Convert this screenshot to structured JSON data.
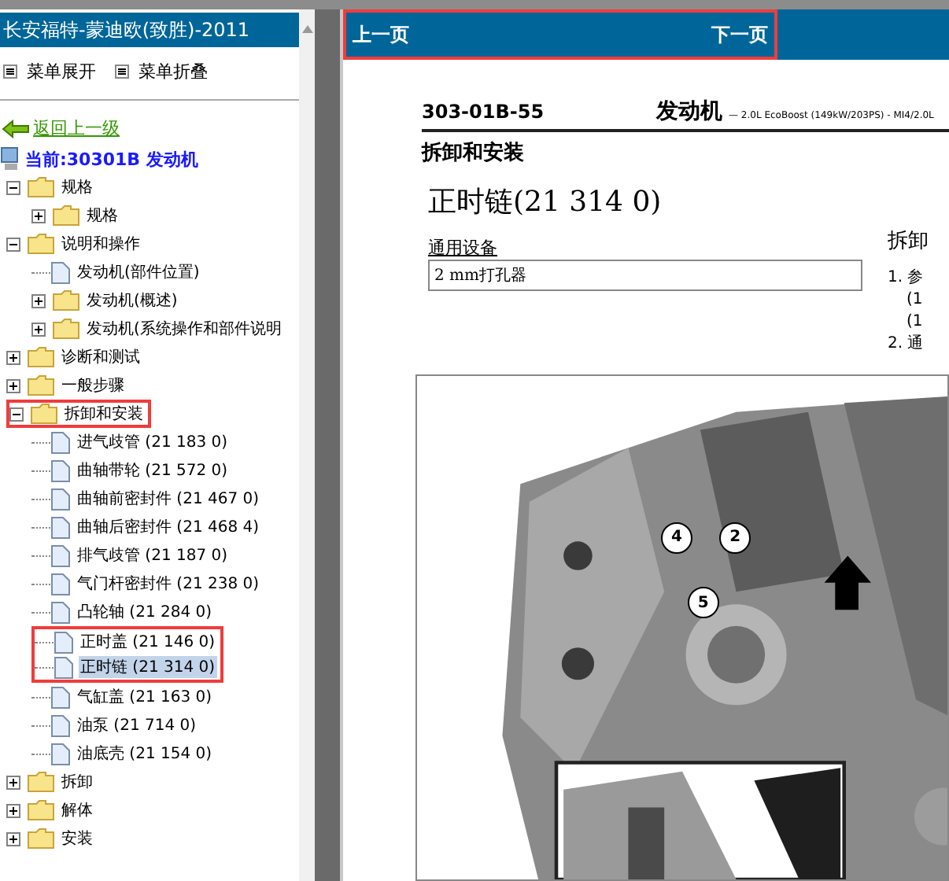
{
  "sidebar": {
    "title": "长安福特-蒙迪欧(致胜)-2011",
    "menu_buttons": [
      "菜单展开",
      "菜单折叠"
    ],
    "back_link": "返回上一级",
    "current": "当前:30301B 发动机",
    "tree": [
      {
        "label": "规格",
        "kind": "folder",
        "expanded": true,
        "annotated": false,
        "children": [
          {
            "label": "规格",
            "kind": "folder",
            "expanded": false,
            "annotated": false
          }
        ]
      },
      {
        "label": "说明和操作",
        "kind": "folder",
        "expanded": true,
        "annotated": false,
        "children": [
          {
            "label": "发动机(部件位置)",
            "kind": "page",
            "selected": false,
            "annotated": false
          },
          {
            "label": "发动机(概述)",
            "kind": "folder",
            "expanded": false,
            "annotated": false
          },
          {
            "label": "发动机(系统操作和部件说明",
            "kind": "folder",
            "expanded": false,
            "annotated": false
          }
        ]
      },
      {
        "label": "诊断和测试",
        "kind": "folder",
        "expanded": false,
        "annotated": false
      },
      {
        "label": "一般步骤",
        "kind": "folder",
        "expanded": false,
        "annotated": false
      },
      {
        "label": "拆卸和安装",
        "kind": "folder",
        "expanded": true,
        "annotated": true,
        "children": [
          {
            "label": "进气歧管 (21 183 0)",
            "kind": "page",
            "selected": false,
            "annotated": false
          },
          {
            "label": "曲轴带轮 (21 572 0)",
            "kind": "page",
            "selected": false,
            "annotated": false
          },
          {
            "label": "曲轴前密封件 (21 467 0)",
            "kind": "page",
            "selected": false,
            "annotated": false
          },
          {
            "label": "曲轴后密封件 (21 468 4)",
            "kind": "page",
            "selected": false,
            "annotated": false
          },
          {
            "label": "排气歧管 (21 187 0)",
            "kind": "page",
            "selected": false,
            "annotated": false
          },
          {
            "label": "气门杆密封件 (21 238 0)",
            "kind": "page",
            "selected": false,
            "annotated": false
          },
          {
            "label": "凸轮轴 (21 284 0)",
            "kind": "page",
            "selected": false,
            "annotated": false
          },
          {
            "label": "正时盖 (21 146 0)",
            "kind": "page",
            "selected": false,
            "annotated": true
          },
          {
            "label": "正时链 (21 314 0)",
            "kind": "page",
            "selected": true,
            "annotated": true
          },
          {
            "label": "气缸盖 (21 163 0)",
            "kind": "page",
            "selected": false,
            "annotated": false
          },
          {
            "label": "油泵 (21 714 0)",
            "kind": "page",
            "selected": false,
            "annotated": false
          },
          {
            "label": "油底壳 (21 154 0)",
            "kind": "page",
            "selected": false,
            "annotated": false
          }
        ]
      },
      {
        "label": "拆卸",
        "kind": "folder",
        "expanded": false,
        "annotated": false
      },
      {
        "label": "解体",
        "kind": "folder",
        "expanded": false,
        "annotated": false
      },
      {
        "label": "安装",
        "kind": "folder",
        "expanded": false,
        "annotated": false
      }
    ]
  },
  "nav": {
    "prev": "上一页",
    "next": "下一页",
    "annotated": true
  },
  "document": {
    "code": "303-01B-55",
    "chapter": "发动机",
    "subtitle": "— 2.0L EcoBoost (149kW/203PS) - MI4/2.0L",
    "section": "拆卸和安装",
    "title": "正时链(21 314 0)",
    "equipment_label": "通用设备",
    "equipment": [
      "2 mm打孔器"
    ],
    "right_heading": "拆卸",
    "steps": [
      "1. 参",
      "(1",
      "(1",
      "2. 通"
    ],
    "figure": {
      "kind": "picture",
      "callouts": [
        "4",
        "2",
        "5"
      ]
    }
  }
}
